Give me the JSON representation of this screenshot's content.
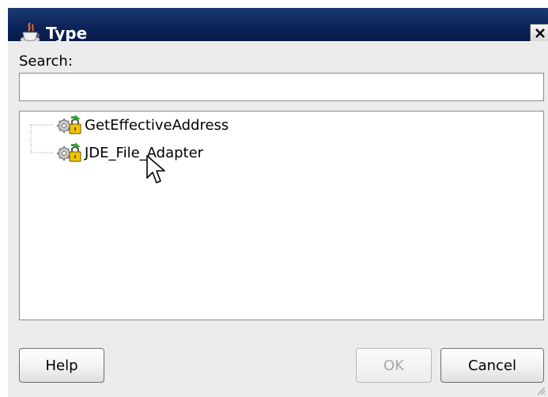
{
  "window": {
    "title": "Type",
    "title_icon": "cup-icon",
    "close_icon": "close-icon"
  },
  "search": {
    "label": "Search:",
    "value": "",
    "placeholder": ""
  },
  "tree": {
    "items": [
      {
        "label": "GetEffectiveAddress",
        "icon": "gear-lock-icon"
      },
      {
        "label": "JDE_File_Adapter",
        "icon": "gear-lock-icon"
      }
    ]
  },
  "buttons": {
    "help": "Help",
    "ok": "OK",
    "cancel": "Cancel"
  },
  "colors": {
    "titlebar": "#0c2459",
    "dialog_bg": "#ececec",
    "disabled_text": "#a8a8a8"
  }
}
